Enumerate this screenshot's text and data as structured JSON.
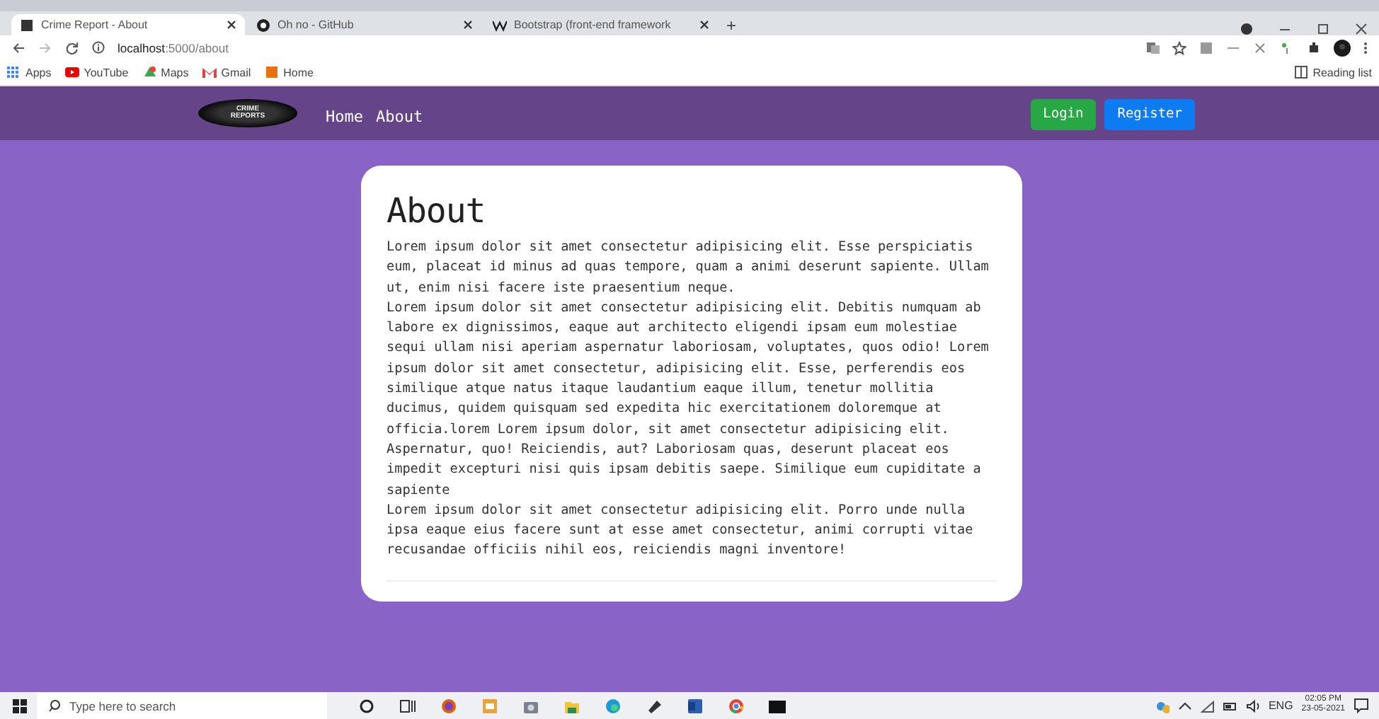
{
  "browser": {
    "tabs": [
      {
        "title": "Crime Report - About",
        "selected": true
      },
      {
        "title": "Oh no - GitHub",
        "selected": false
      },
      {
        "title": "Bootstrap (front-end framework",
        "selected": false
      }
    ],
    "new_tab": "+",
    "address": "**localhost**:5000/about",
    "bookmarks": [
      "Apps",
      "YouTube",
      "Maps",
      "Gmail",
      "Home"
    ],
    "reading_list": "Reading list"
  },
  "navbar": {
    "logo": [
      "CRIME",
      "REPORTS"
    ],
    "links": [
      "Home",
      "About"
    ],
    "buttons": [
      {
        "label": "Login",
        "kind": "success"
      },
      {
        "label": "Register",
        "kind": "primary"
      }
    ]
  },
  "card": {
    "title": "About",
    "paragraphs": [
      "Lorem ipsum dolor sit amet consectetur adipisicing elit. Esse perspiciatis eum, placeat id minus ad quas tempore, quam a animi deserunt sapiente. Ullam ut, enim nisi facere iste praesentium neque.",
      "Lorem ipsum dolor sit amet consectetur adipisicing elit. Debitis numquam ab labore ex dignissimos, eaque aut architecto eligendi ipsam eum molestiae sequi ullam nisi aperiam aspernatur laboriosam, voluptates, quos odio! Lorem ipsum dolor sit amet consectetur, adipisicing elit. Esse, perferendis eos similique atque natus itaque laudantium eaque illum, tenetur mollitia ducimus, quidem quisquam sed expedita hic exercitationem doloremque at officia.lorem Lorem ipsum dolor, sit amet consectetur adipisicing elit. Aspernatur, quo! Reiciendis, aut? Laboriosam quas, deserunt placeat eos impedit excepturi nisi quis ipsam debitis saepe. Similique eum cupiditate a sapiente",
      "Lorem ipsum dolor sit amet consectetur adipisicing elit. Porro unde nulla ipsa eaque eius facere sunt at esse amet consectetur, animi corrupti vitae recusandae officiis nihil eos, reiciendis magni inventore!"
    ]
  },
  "taskbar": {
    "search_placeholder": "Type here to search",
    "language": "ENG",
    "time": "02:05 PM",
    "date": "23-05-2021"
  }
}
